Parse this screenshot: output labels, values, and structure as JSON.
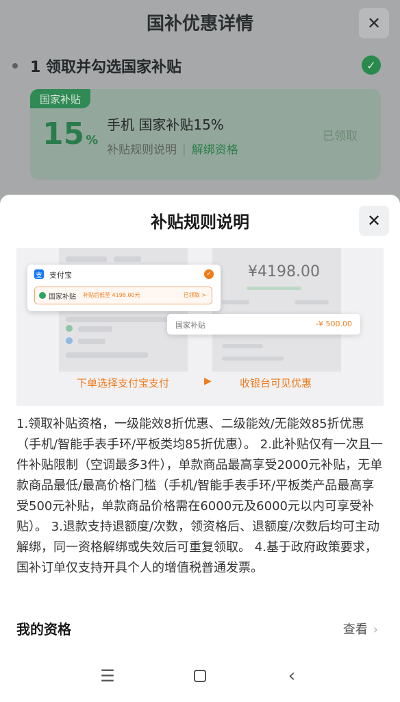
{
  "background": {
    "title": "国补优惠详情",
    "close_icon": "close-icon",
    "step": {
      "title": "1 领取并勾选国家补贴",
      "check_icon": "check-circle-icon"
    },
    "subsidy_card": {
      "tag": "国家补贴",
      "percent": "15",
      "percent_unit": "%",
      "name": "手机 国家补贴15%",
      "rules_link": "补贴规则说明",
      "unbind_link": "解绑资格",
      "status": "已领取"
    }
  },
  "sheet": {
    "title": "补贴规则说明",
    "illustration": {
      "pay_name": "支付宝",
      "pay_tag": "国家补贴",
      "pay_sub": "补贴后低至 4198.00元",
      "pay_status": "已领取 >",
      "price": "¥4198.00",
      "discount_label": "国家补贴",
      "discount_value": "-¥ 500.00",
      "step_left": "下单选择支付宝支付",
      "step_right": "收银台可见优惠"
    },
    "rules_text": "1.领取补贴资格，一级能效8折优惠、二级能效/无能效85折优惠（手机/智能手表手环/平板类均85折优惠）。 2.此补贴仅有一次且一件补贴限制（空调最多3件），单款商品最高享受2000元补贴，无单款商品最低/最高价格门槛（手机/智能手表手环/平板类产品最高享受500元补贴，单款商品价格需在6000元及6000元以内可享受补贴）。 3.退款支持退额度/次数，领资格后、退额度/次数后均可主动解绑，同一资格解绑或失效后可重复领取。 4.基于政府政策要求，国补订单仅支持开具个人的增值税普通发票。",
    "my_qualification": {
      "title": "我的资格",
      "view_label": "查看"
    }
  },
  "navbar": {
    "menu_icon": "menu-icon",
    "home_icon": "home-icon",
    "back_icon": "back-icon"
  },
  "colors": {
    "accent_green": "#2a8a4e",
    "accent_orange": "#f07b1a"
  }
}
